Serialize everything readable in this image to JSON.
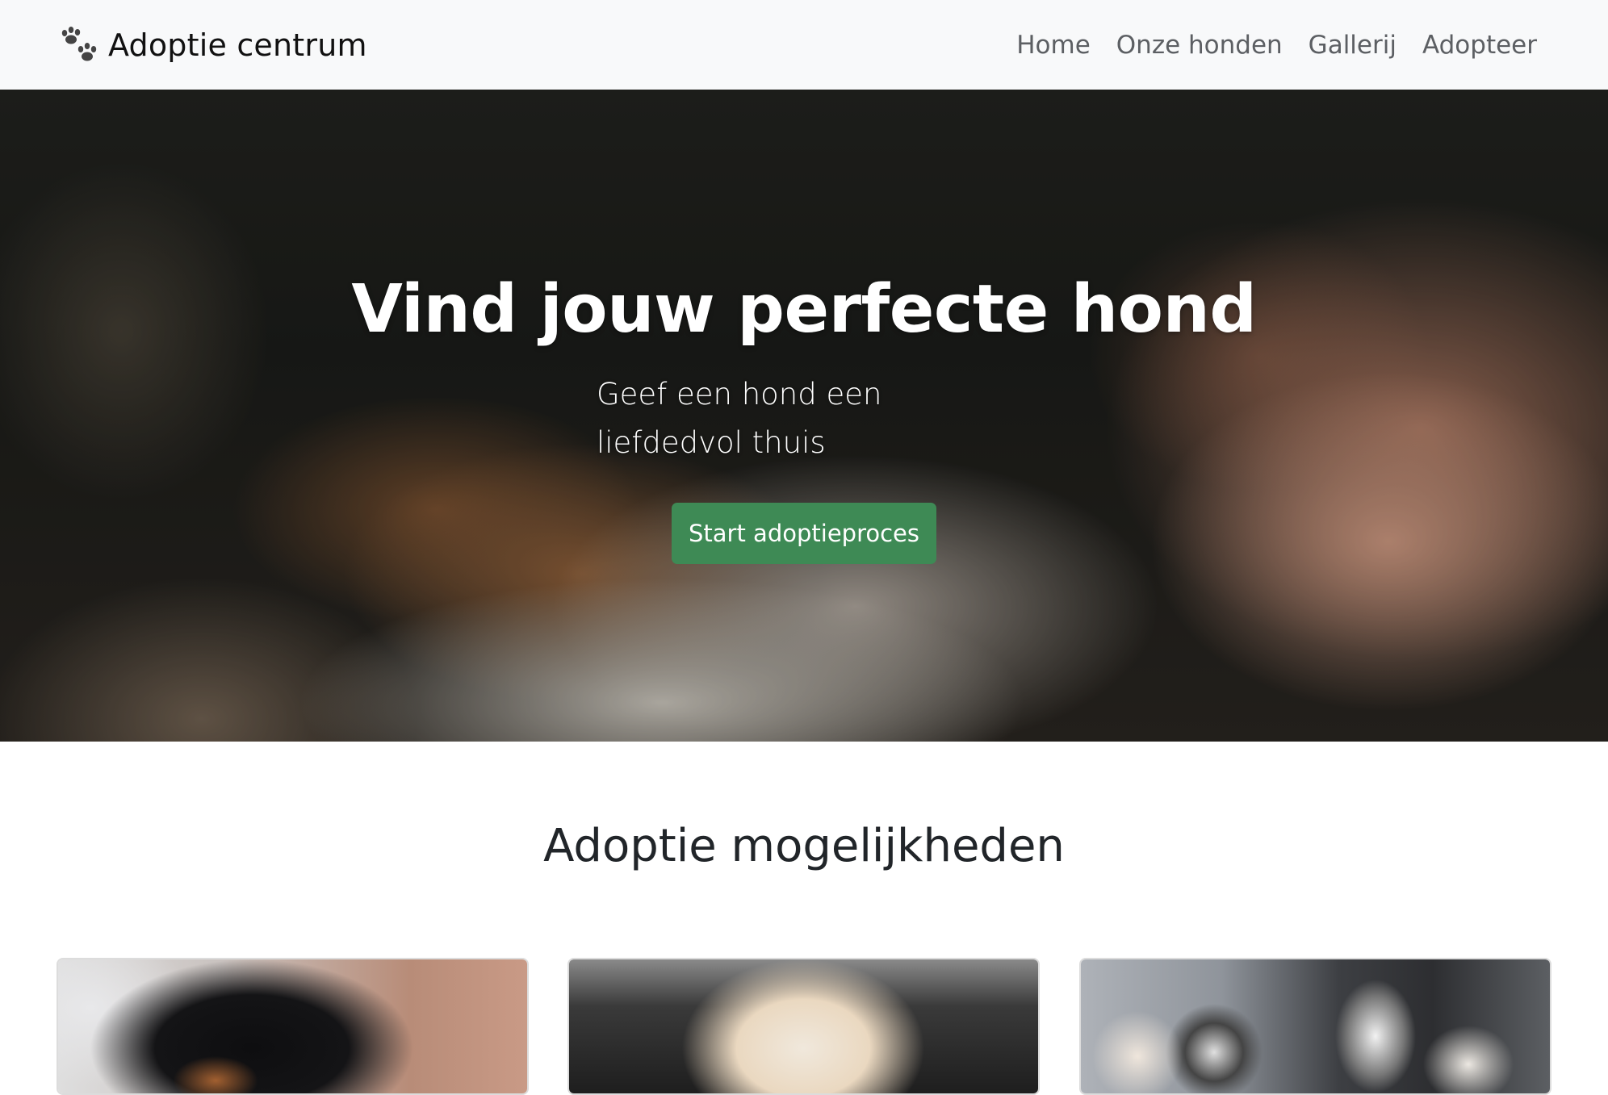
{
  "navbar": {
    "brand_text": "Adoptie centrum",
    "brand_icon": "paw-icon",
    "links": [
      {
        "label": "Home"
      },
      {
        "label": "Onze honden"
      },
      {
        "label": "Gallerij"
      },
      {
        "label": "Adopteer"
      }
    ]
  },
  "hero": {
    "title": "Vind jouw perfecte hond",
    "subtitle": "Geef een hond een liefdedvol thuis",
    "button_label": "Start adoptieproces",
    "button_color": "#3e8a55"
  },
  "section": {
    "title": "Adoptie mogelijkheden"
  },
  "colors": {
    "navbar_bg": "#f8f9fa",
    "nav_link": "#5c5f63",
    "accent_green": "#3e8a55"
  }
}
